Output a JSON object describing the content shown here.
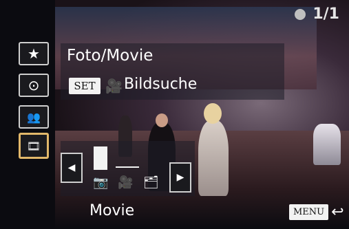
{
  "counter": {
    "text": "1/1"
  },
  "sidebar": {
    "items": [
      {
        "icon": "star-icon",
        "glyph": "★"
      },
      {
        "icon": "date-clock-icon",
        "glyph": "⊙"
      },
      {
        "icon": "people-icon",
        "glyph": "👥"
      },
      {
        "icon": "photo-movie-icon",
        "glyph": "🎞",
        "selected": true
      }
    ]
  },
  "overlay": {
    "title": "Foto/Movie",
    "set_label": "SET",
    "subtitle": "Bildsuche"
  },
  "selector": {
    "mode_icons": [
      "camera-icon",
      "movie-camera-icon",
      "photo-stack-icon"
    ],
    "active_mode": "movie-camera-icon",
    "current_label": "Movie"
  },
  "footer": {
    "menu_label": "MENU"
  },
  "colors": {
    "accent": "#f0b83a"
  }
}
